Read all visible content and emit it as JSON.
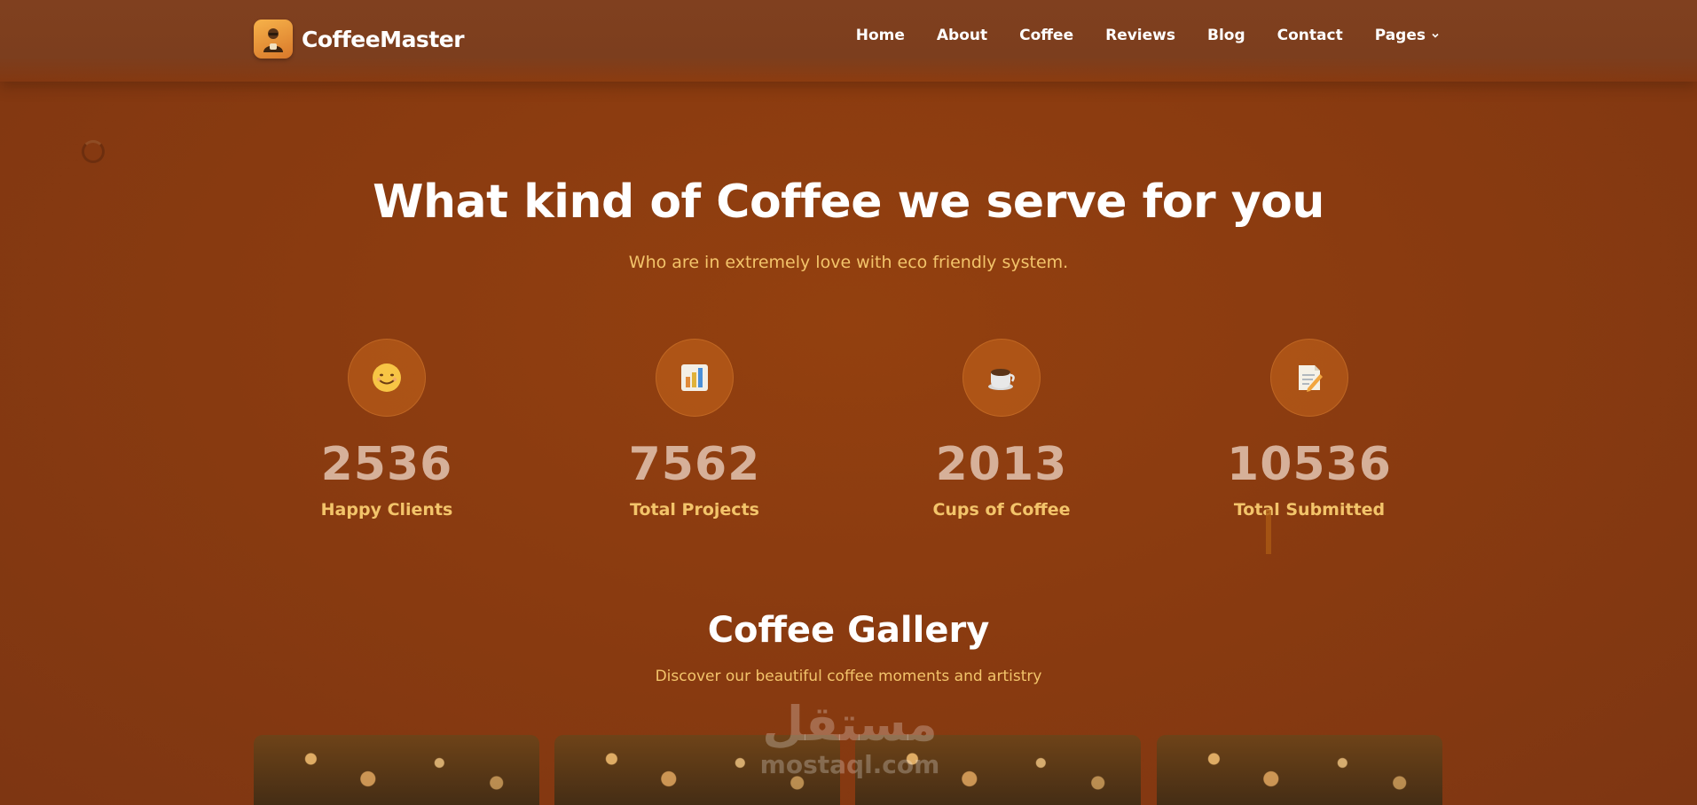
{
  "nav": {
    "brand": "CoffeeMaster",
    "items": [
      {
        "label": "Home"
      },
      {
        "label": "About"
      },
      {
        "label": "Coffee"
      },
      {
        "label": "Reviews"
      },
      {
        "label": "Blog"
      },
      {
        "label": "Contact"
      },
      {
        "label": "Pages"
      }
    ]
  },
  "hero": {
    "title": "What kind of Coffee we serve for you",
    "subtitle": "Who are in extremely love with eco friendly system."
  },
  "stats": [
    {
      "icon": "smile-emoji-icon",
      "value": "2536",
      "label": "Happy Clients"
    },
    {
      "icon": "bar-chart-emoji-icon",
      "value": "7562",
      "label": "Total Projects"
    },
    {
      "icon": "coffee-cup-emoji-icon",
      "value": "2013",
      "label": "Cups of Coffee"
    },
    {
      "icon": "memo-emoji-icon",
      "value": "10536",
      "label": "Total Submitted"
    }
  ],
  "gallery": {
    "title": "Coffee Gallery",
    "subtitle": "Discover our beautiful coffee moments and artistry"
  },
  "watermark": {
    "arabic": "مستقل",
    "latin": "mostaql.com"
  },
  "colors": {
    "background": "#8a3b10",
    "accent": "#f3c46a",
    "stat_value": "#d6b099"
  }
}
